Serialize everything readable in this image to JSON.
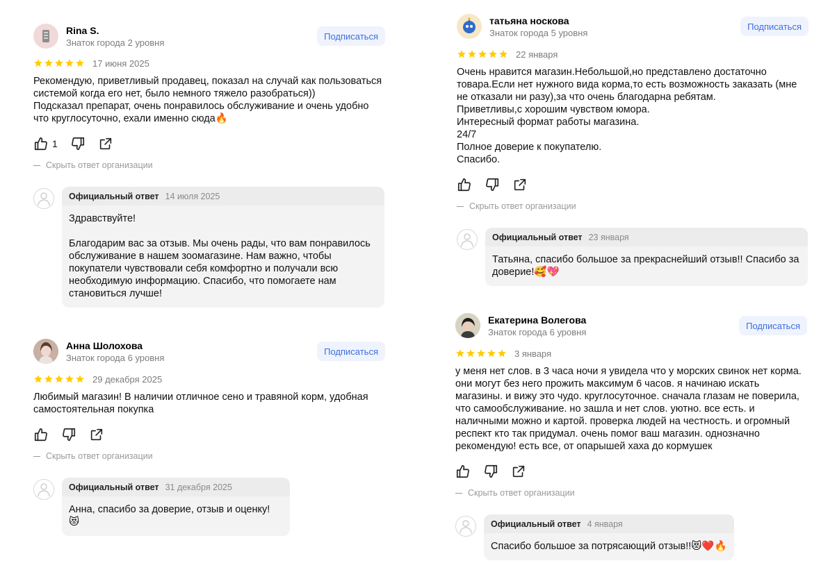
{
  "common": {
    "subscribe_label": "Подписаться",
    "hide_reply_label": "Скрыть ответ организации",
    "official_reply_label": "Официальный ответ",
    "star_color": "#fc0",
    "link_color": "#3f6edf"
  },
  "reviews": [
    {
      "author": "Rina S.",
      "level": "Знаток города 2 уровня",
      "rating": 5,
      "date": "17 июня 2025",
      "text": "Рекомендую, приветливый продавец, показал на случай как пользоваться системой когда его нет, было немного тяжело разобраться))\nПодсказал препарат, очень понравилось обслуживание и очень удобно что круглосуточно, ехали именно сюда🔥",
      "likes": "1",
      "reply": {
        "date": "14 июля 2025",
        "text": "Здравствуйте!\n\nБлагодарим вас за отзыв. Мы очень рады, что вам понравилось обслуживание в нашем зоомагазине. Нам важно, чтобы покупатели чувствовали себя комфортно и получали всю необходимую информацию. Спасибо, что помогаете нам становиться лучше!"
      }
    },
    {
      "author": "Анна Шолохова",
      "level": "Знаток города 6 уровня",
      "rating": 5,
      "date": "29 декабря 2025",
      "text": "Любимый магазин! В наличии отличное сено и травяной корм, удобная самостоятельная покупка",
      "likes": "",
      "reply": {
        "date": "31 декабря 2025",
        "text": "Анна, спасибо за доверие, отзыв и оценку! 😻"
      }
    },
    {
      "author": "татьяна носкова",
      "level": "Знаток города 5 уровня",
      "rating": 5,
      "date": "22 января",
      "text": "Очень нравится магазин.Небольшой,но представлено достаточно товара.Если нет нужного вида корма,то есть возможность заказать (мне не отказали ни разу),за что очень благодарна ребятам.\nПриветливы,с хорошим чувством юмора.\nИнтересный формат работы магазина.\n24/7\nПолное доверие к покупателю.\nСпасибо.",
      "likes": "",
      "reply": {
        "date": "23 января",
        "text": "Татьяна, спасибо большое за прекраснейший отзыв!! Спасибо за доверие!🥰💖"
      }
    },
    {
      "author": "Екатерина Волегова",
      "level": "Знаток города 6 уровня",
      "rating": 5,
      "date": "3 января",
      "text": "у меня нет слов. в 3 часа ночи я увидела что у морских свинок нет корма. они могут без него прожить максимум 6 часов. я начинаю искать магазины. и вижу это чудо. круглосуточное. сначала глазам не поверила, что самообслуживание. но зашла и нет слов. уютно. все есть. и наличными можно и картой. проверка людей на честность. и огромный респект кто так придумал. очень помог ваш магазин. однозначно рекомендую! есть все, от опарышей хаха до кормушек",
      "likes": "",
      "reply": {
        "date": "4 января",
        "text": "Спасибо большое за потрясающий отзыв!!😻❤️🔥"
      }
    }
  ]
}
